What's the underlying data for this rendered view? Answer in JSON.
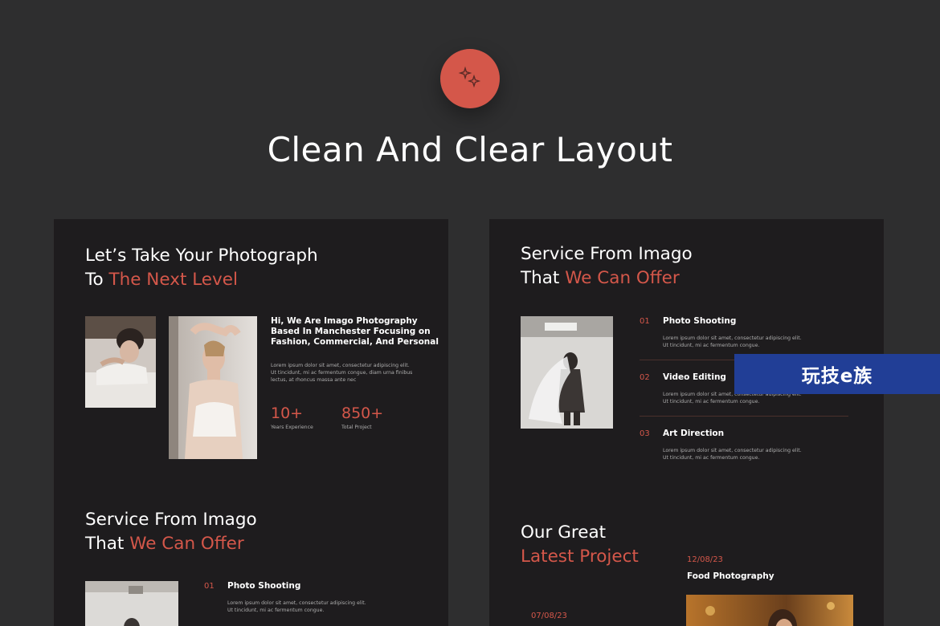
{
  "header": {
    "icon": "sparkles-icon",
    "title": "Clean And Clear Layout",
    "accent_color": "#d4574a"
  },
  "left_panel": {
    "hero": {
      "line1": "Let’s Take Your Photograph",
      "line2_prefix": "To ",
      "line2_accent": "The Next Level"
    },
    "intro": {
      "heading": [
        "Hi, We Are Imago Photography",
        "Based In Manchester Focusing on",
        "Fashion, Commercial, And Personal"
      ],
      "body": [
        "Lorem ipsum dolor sit amet, consectetur adipiscing elit.",
        "Ut tincidunt, mi ac fermentum congue, diam urna finibus",
        "lectus, at rhoncus massa ante nec"
      ]
    },
    "stats": [
      {
        "value": "10+",
        "label": "Years Experience"
      },
      {
        "value": "850+",
        "label": "Total Project"
      }
    ],
    "services": {
      "line1": "Service From Imago",
      "line2_prefix": "That ",
      "line2_accent": "We Can Offer",
      "items": [
        {
          "num": "01",
          "name": "Photo Shooting",
          "desc1": "Lorem ipsum dolor sit amet, consectetur adipiscing elit.",
          "desc2": "Ut tincidunt, mi ac fermentum congue."
        }
      ]
    }
  },
  "right_panel": {
    "services": {
      "line1": "Service From Imago",
      "line2_prefix": "That ",
      "line2_accent": "We Can Offer",
      "items": [
        {
          "num": "01",
          "name": "Photo Shooting",
          "desc1": "Lorem ipsum dolor sit amet, consectetur adipiscing elit.",
          "desc2": "Ut tincidunt, mi ac fermentum congue."
        },
        {
          "num": "02",
          "name": "Video Editing",
          "desc1": "Lorem ipsum dolor sit amet, consectetur adipiscing elit.",
          "desc2": "Ut tincidunt, mi ac fermentum congue."
        },
        {
          "num": "03",
          "name": "Art Direction",
          "desc1": "Lorem ipsum dolor sit amet, consectetur adipiscing elit.",
          "desc2": "Ut tincidunt, mi ac fermentum congue."
        }
      ]
    },
    "projects": {
      "line1": "Our Great",
      "line2": "Latest Project",
      "items": [
        {
          "date": "12/08/23",
          "name": "Food Photography"
        },
        {
          "date": "07/08/23"
        }
      ]
    }
  },
  "watermark": {
    "text": "玩技e族"
  }
}
